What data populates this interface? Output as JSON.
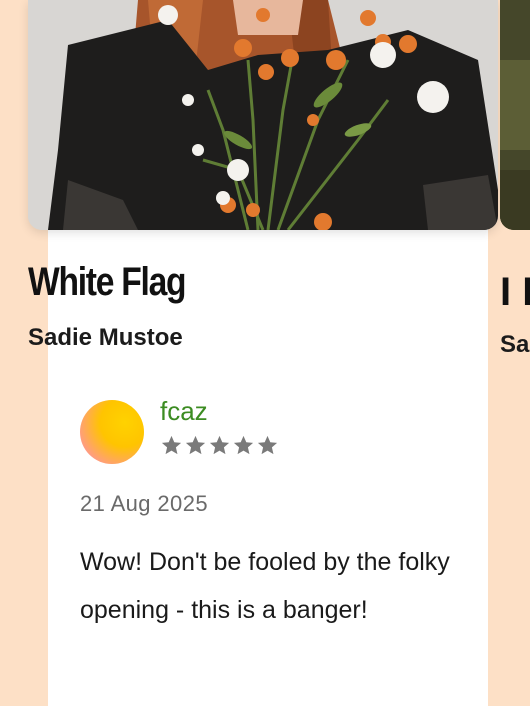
{
  "song": {
    "title": "White Flag",
    "artist": "Sadie Mustoe",
    "cover_art": "portrait-with-wildflowers-image"
  },
  "next_song": {
    "title_partial": "I F",
    "artist_partial": "Sa"
  },
  "review": {
    "username": "fcaz",
    "rating": 5,
    "rating_max": 5,
    "date": "21 Aug 2025",
    "text": "Wow! Don't be fooled by the folky opening - this is a banger!"
  },
  "colors": {
    "background": "#fde0c6",
    "card": "#ffffff",
    "username": "#3c8c22",
    "star": "#7a7a7a",
    "avatar_accent": "#ffc400"
  }
}
